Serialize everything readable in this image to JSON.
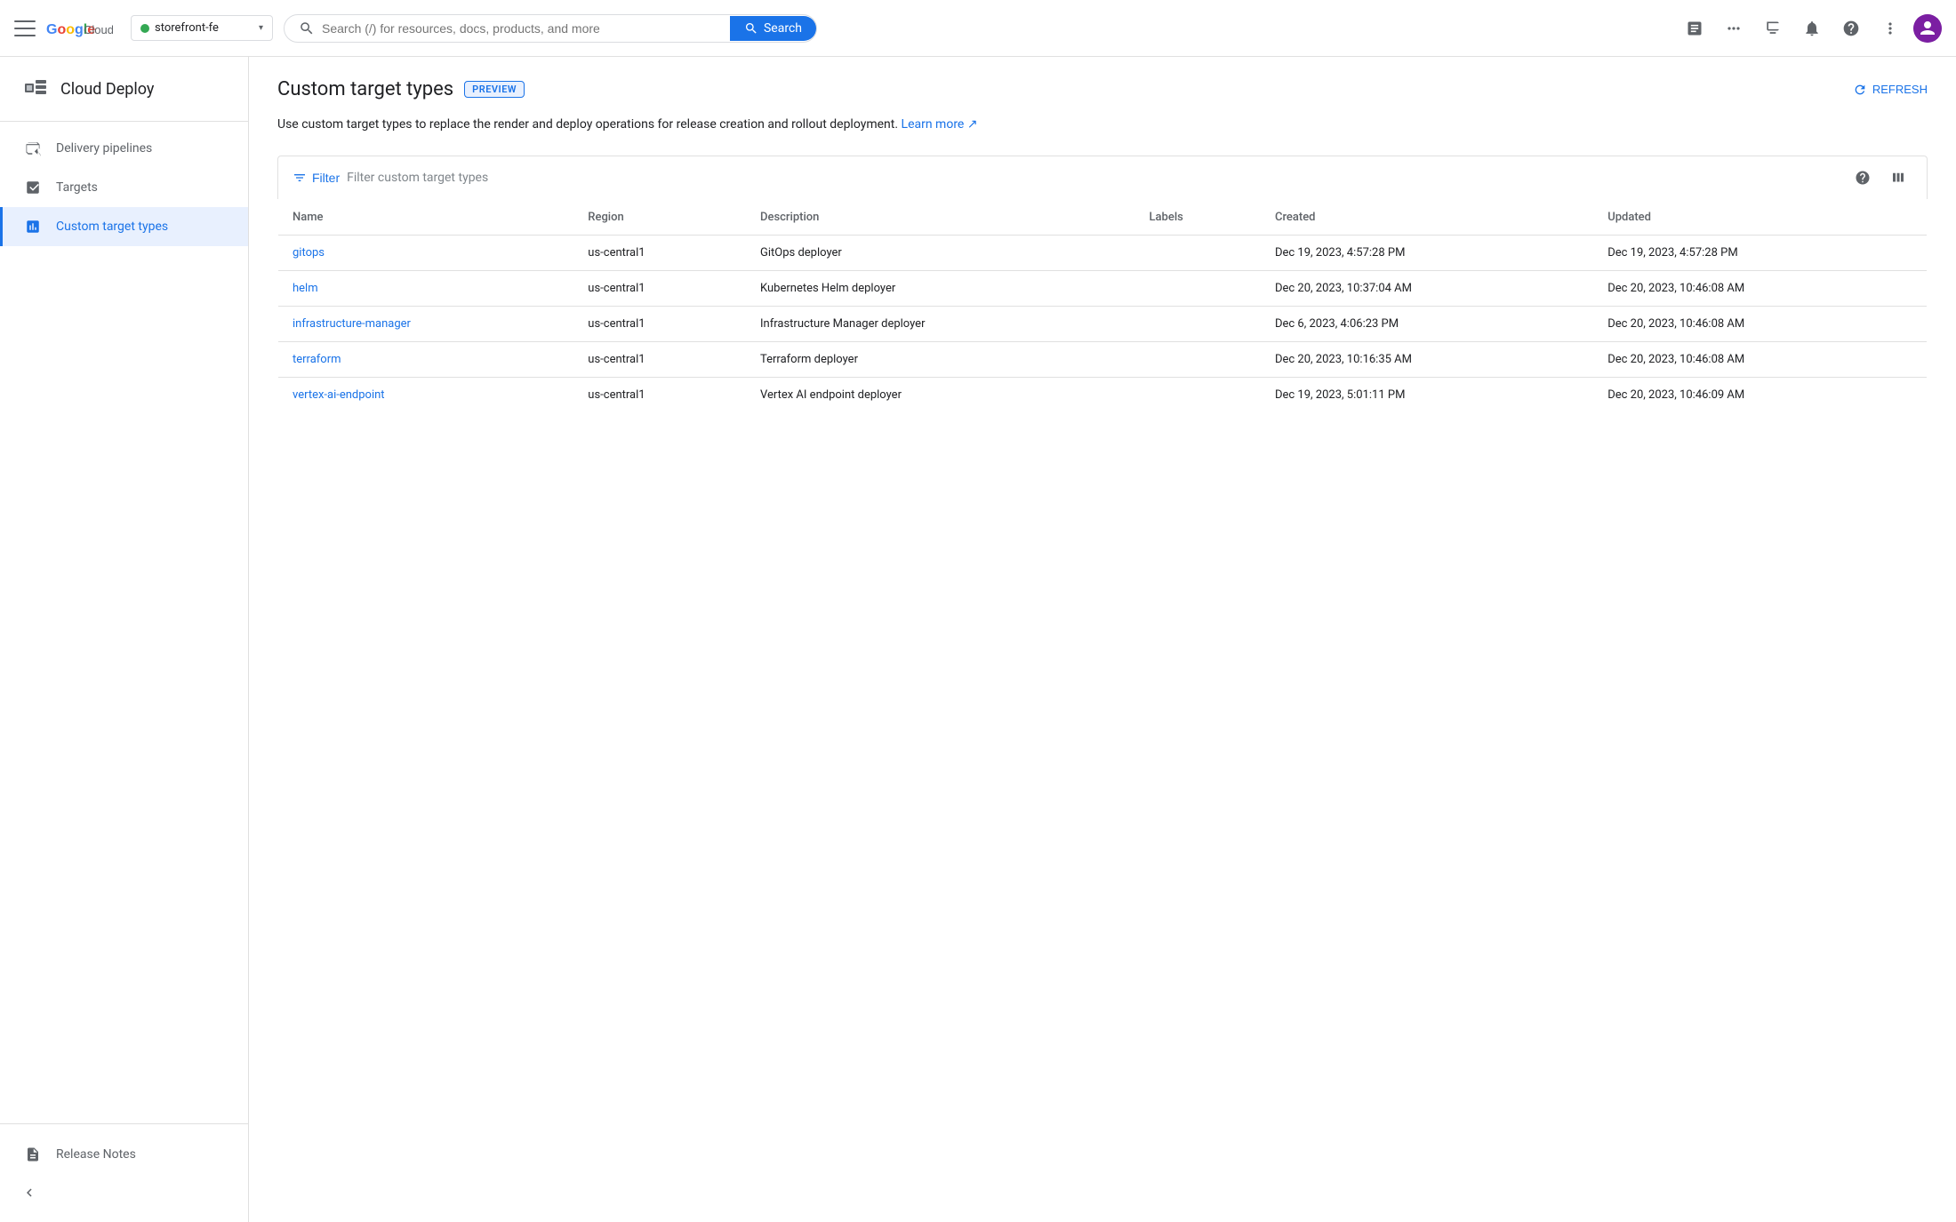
{
  "topbar": {
    "project": {
      "name": "storefront-fe",
      "chevron": "▾"
    },
    "search": {
      "placeholder": "Search (/) for resources, docs, products, and more",
      "button_label": "Search"
    },
    "icons": {
      "edit": "✎",
      "grid": "⋮⋮⋮",
      "monitor": "▤",
      "bell": "🔔",
      "help": "?",
      "more": "⋮"
    }
  },
  "sidebar": {
    "title": "Cloud Deploy",
    "nav_items": [
      {
        "id": "delivery-pipelines",
        "label": "Delivery pipelines",
        "active": false
      },
      {
        "id": "targets",
        "label": "Targets",
        "active": false
      },
      {
        "id": "custom-target-types",
        "label": "Custom target types",
        "active": true
      }
    ],
    "bottom_items": [
      {
        "id": "release-notes",
        "label": "Release Notes"
      }
    ],
    "collapse_label": "❮"
  },
  "page": {
    "title": "Custom target types",
    "preview_badge": "PREVIEW",
    "refresh_label": "REFRESH",
    "description": "Use custom target types to replace the render and deploy operations for release creation and rollout deployment.",
    "learn_more_label": "Learn more",
    "learn_more_icon": "↗"
  },
  "table": {
    "filter_label": "Filter",
    "filter_placeholder": "Filter custom target types",
    "columns": [
      {
        "id": "name",
        "label": "Name"
      },
      {
        "id": "region",
        "label": "Region"
      },
      {
        "id": "description",
        "label": "Description"
      },
      {
        "id": "labels",
        "label": "Labels"
      },
      {
        "id": "created",
        "label": "Created"
      },
      {
        "id": "updated",
        "label": "Updated"
      }
    ],
    "rows": [
      {
        "name": "gitops",
        "region": "us-central1",
        "description": "GitOps deployer",
        "labels": "",
        "created": "Dec 19, 2023, 4:57:28 PM",
        "updated": "Dec 19, 2023, 4:57:28 PM"
      },
      {
        "name": "helm",
        "region": "us-central1",
        "description": "Kubernetes Helm deployer",
        "labels": "",
        "created": "Dec 20, 2023, 10:37:04 AM",
        "updated": "Dec 20, 2023, 10:46:08 AM"
      },
      {
        "name": "infrastructure-manager",
        "region": "us-central1",
        "description": "Infrastructure Manager deployer",
        "labels": "",
        "created": "Dec 6, 2023, 4:06:23 PM",
        "updated": "Dec 20, 2023, 10:46:08 AM"
      },
      {
        "name": "terraform",
        "region": "us-central1",
        "description": "Terraform deployer",
        "labels": "",
        "created": "Dec 20, 2023, 10:16:35 AM",
        "updated": "Dec 20, 2023, 10:46:08 AM"
      },
      {
        "name": "vertex-ai-endpoint",
        "region": "us-central1",
        "description": "Vertex AI endpoint deployer",
        "labels": "",
        "created": "Dec 19, 2023, 5:01:11 PM",
        "updated": "Dec 20, 2023, 10:46:09 AM"
      }
    ]
  }
}
